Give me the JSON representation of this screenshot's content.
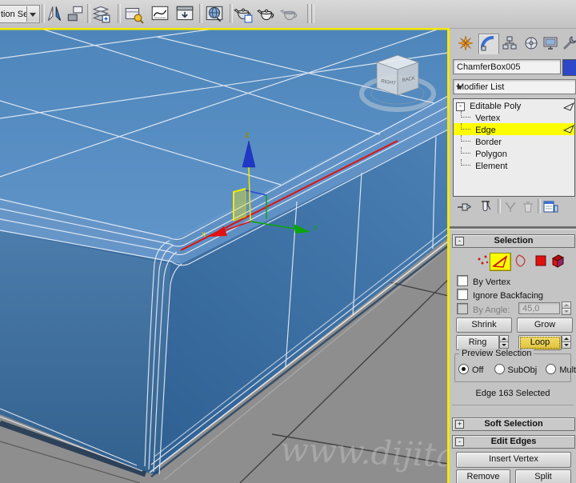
{
  "toolbar": {
    "named_selection_combo": {
      "value": "tion Se"
    },
    "icons": [
      "mirror",
      "align",
      "layer-manager",
      "scene-explorer",
      "curve-editor",
      "schematic-view",
      "render-setup",
      "rendered-frame-window",
      "render-production",
      "activeshade"
    ]
  },
  "command_panel": {
    "tabs": [
      "Create",
      "Modify",
      "Hierarchy",
      "Motion",
      "Display",
      "Utilities"
    ],
    "active_tab": "Modify",
    "object_name": "ChamferBox005",
    "object_color": "#2e46c8",
    "modifier_list_label": "Modifier List",
    "stack": {
      "expand_glyph": "-",
      "items": [
        {
          "label": "Editable Poly",
          "selected": false
        },
        {
          "label": "Vertex",
          "selected": false
        },
        {
          "label": "Edge",
          "selected": true
        },
        {
          "label": "Border",
          "selected": false
        },
        {
          "label": "Polygon",
          "selected": false
        },
        {
          "label": "Element",
          "selected": false
        }
      ]
    },
    "stack_tools": [
      "pin-stack",
      "show-end-result",
      "make-unique",
      "remove-modifier",
      "configure-modifier-sets"
    ]
  },
  "selection_rollout": {
    "toggle_glyph": "-",
    "title": "Selection",
    "subobject_icons": [
      "vertex",
      "edge",
      "border",
      "polygon",
      "element"
    ],
    "active_subobject": "edge",
    "by_vertex_label": "By Vertex",
    "ignore_backfacing_label": "Ignore Backfacing",
    "by_angle_label": "By Angle:",
    "by_angle_value": "45,0",
    "shrink_label": "Shrink",
    "grow_label": "Grow",
    "ring_label": "Ring",
    "loop_label": "Loop",
    "preview": {
      "title": "Preview Selection",
      "off": "Off",
      "subobj": "SubObj",
      "multi": "Multi",
      "selected": "Off"
    },
    "status": "Edge 163 Selected"
  },
  "soft_selection_rollout": {
    "toggle_glyph": "+",
    "title": "Soft Selection"
  },
  "edit_edges_rollout": {
    "toggle_glyph": "-",
    "title": "Edit Edges",
    "insert_vertex_label": "Insert Vertex",
    "remove_label": "Remove",
    "split_label": "Split"
  },
  "viewport": {
    "border_color": "#f5e900",
    "watermark": "www.dijitalde",
    "axis_labels": {
      "x": "x",
      "y": "y",
      "z": "z"
    },
    "viewcube": {
      "left_face": "RIGHT",
      "right_face": "BACK"
    },
    "selected_edge_color": "#e01212",
    "colors": {
      "top_face": "#568cc0",
      "right_face": "#4f86bb",
      "left_face": "#47789f",
      "ground": "#8e8e8e",
      "highlight": "#ffff00"
    }
  }
}
